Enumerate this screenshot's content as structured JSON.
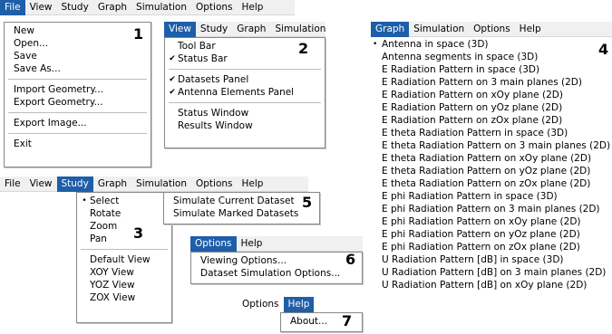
{
  "panel1": {
    "menubar": [
      "File",
      "View",
      "Study",
      "Graph",
      "Simulation",
      "Options",
      "Help"
    ],
    "active_index": 0,
    "items": [
      {
        "label": "New"
      },
      {
        "label": "Open..."
      },
      {
        "label": "Save"
      },
      {
        "label": "Save As..."
      },
      {
        "sep": true
      },
      {
        "label": "Import Geometry..."
      },
      {
        "label": "Export Geometry..."
      },
      {
        "sep": true
      },
      {
        "label": "Export Image..."
      },
      {
        "sep": true
      },
      {
        "label": "Exit"
      }
    ],
    "number": "1"
  },
  "panel2": {
    "menubar": [
      "View",
      "Study",
      "Graph",
      "Simulation"
    ],
    "active_index": 0,
    "items": [
      {
        "label": "Tool Bar"
      },
      {
        "label": "Status Bar",
        "checked": true
      },
      {
        "sep": true
      },
      {
        "label": "Datasets Panel",
        "checked": true
      },
      {
        "label": "Antenna Elements Panel",
        "checked": true
      },
      {
        "sep": true
      },
      {
        "label": "Status Window"
      },
      {
        "label": "Results Window"
      }
    ],
    "check_mark": "✔",
    "number": "2"
  },
  "panel3": {
    "menubar": [
      "File",
      "View",
      "Study",
      "Graph",
      "Simulation",
      "Options",
      "Help"
    ],
    "active_index": 2,
    "items": [
      {
        "label": "Select",
        "bullet": true
      },
      {
        "label": "Rotate"
      },
      {
        "label": "Zoom"
      },
      {
        "label": "Pan"
      },
      {
        "sep": true
      },
      {
        "label": "Default View"
      },
      {
        "label": "XOY View"
      },
      {
        "label": "YOZ View"
      },
      {
        "label": "ZOX View"
      }
    ],
    "bullet_mark": "•",
    "number": "3"
  },
  "panel5": {
    "items": [
      {
        "label": "Simulate Current Dataset"
      },
      {
        "label": "Simulate Marked Datasets"
      }
    ],
    "number": "5"
  },
  "panel6": {
    "menubar": [
      "Options",
      "Help"
    ],
    "active_index": 0,
    "items": [
      {
        "label": "Viewing Options..."
      },
      {
        "label": "Dataset Simulation Options..."
      }
    ],
    "number": "6"
  },
  "panel7": {
    "menubar": [
      "Options",
      "Help"
    ],
    "active_index": 1,
    "items": [
      {
        "label": "About..."
      }
    ],
    "number": "7"
  },
  "panel4": {
    "menubar": [
      "Graph",
      "Simulation",
      "Options",
      "Help"
    ],
    "active_index": 0,
    "bullet_mark": "•",
    "items": [
      "Antenna in space (3D)",
      "Antenna segments in space (3D)",
      "E Radiation Pattern in space (3D)",
      "E Radiation Pattern on 3 main planes (2D)",
      "E Radiation Pattern on xOy plane (2D)",
      "E Radiation Pattern on yOz plane (2D)",
      "E Radiation Pattern on zOx plane (2D)",
      "E theta Radiation Pattern in space (3D)",
      "E theta Radiation Pattern on 3 main planes (2D)",
      "E theta Radiation Pattern on xOy plane (2D)",
      "E theta Radiation Pattern on yOz plane (2D)",
      "E theta Radiation Pattern on zOx plane (2D)",
      "E phi Radiation Pattern in space (3D)",
      "E phi Radiation Pattern on 3 main planes (2D)",
      "E phi Radiation Pattern on xOy plane (2D)",
      "E phi Radiation Pattern on yOz plane (2D)",
      "E phi Radiation Pattern on zOx plane (2D)",
      "U Radiation Pattern [dB] in space (3D)",
      "U Radiation Pattern [dB] on 3 main planes (2D)",
      "U Radiation Pattern [dB] on xOy plane (2D)"
    ],
    "number": "4"
  },
  "colors": {
    "active_menu": "#1f5ea8",
    "menubar_bg": "#f0f0f0"
  }
}
